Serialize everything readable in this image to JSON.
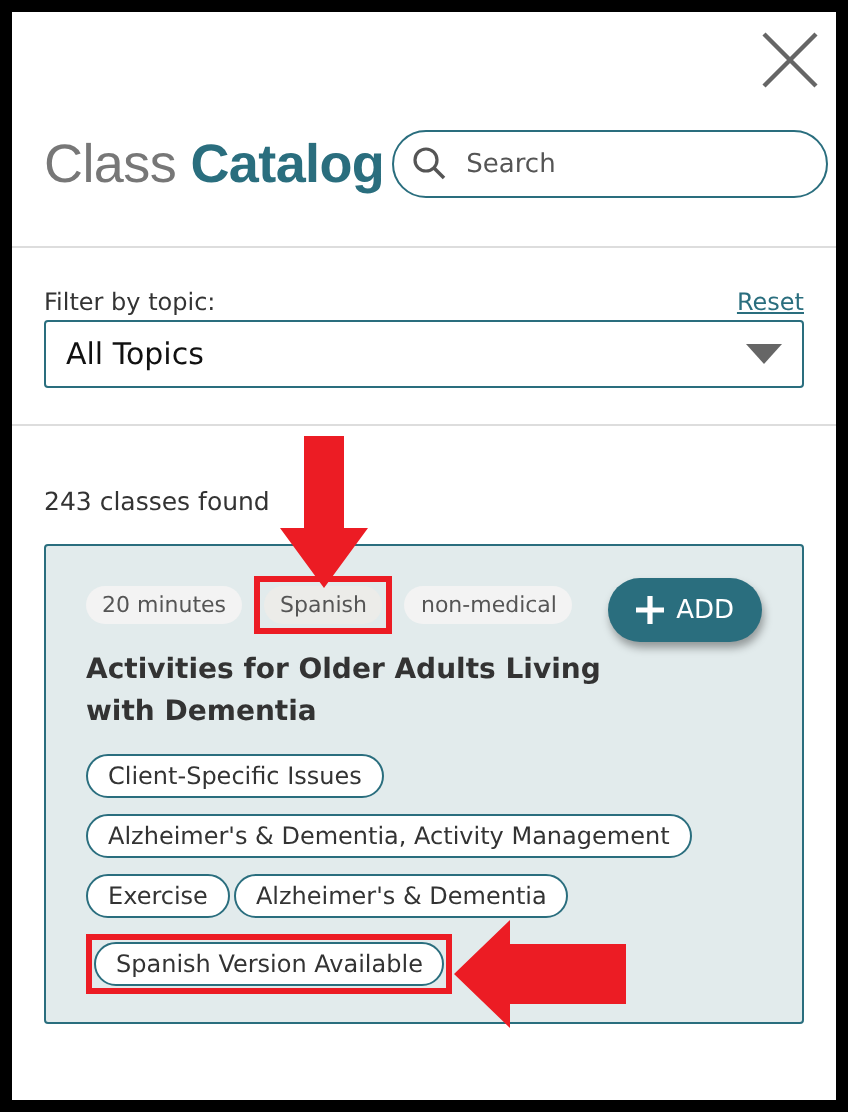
{
  "title": {
    "light": "Class",
    "bold": "Catalog"
  },
  "search": {
    "placeholder": "Search"
  },
  "filter": {
    "label": "Filter by topic:",
    "reset": "Reset",
    "value": "All Topics"
  },
  "result_count": "243 classes found",
  "card": {
    "badges": [
      {
        "text": "20 minutes",
        "highlighted": false
      },
      {
        "text": "Spanish",
        "highlighted": true
      },
      {
        "text": "non-medical",
        "highlighted": false
      }
    ],
    "add_button": "ADD",
    "title": "Activities for Older Adults Living with Dementia",
    "tags": [
      {
        "text": "Client-Specific Issues",
        "highlighted": false
      },
      {
        "text": "Alzheimer's & Dementia, Activity Management",
        "highlighted": false
      },
      {
        "text": "Exercise",
        "highlighted": false
      },
      {
        "text": "Alzheimer's & Dementia",
        "highlighted": false
      },
      {
        "text": "Spanish Version Available",
        "highlighted": true
      }
    ]
  }
}
